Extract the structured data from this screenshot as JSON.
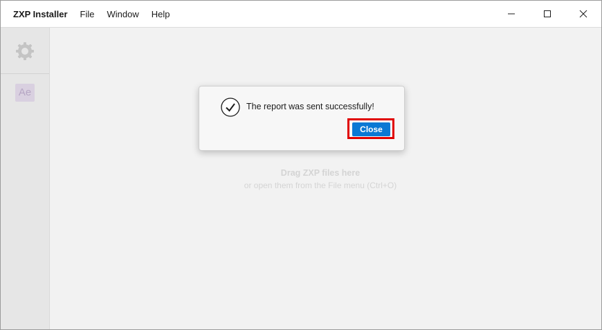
{
  "window": {
    "title": "ZXP Installer",
    "menu": [
      {
        "label": "File"
      },
      {
        "label": "Window"
      },
      {
        "label": "Help"
      }
    ],
    "controls": [
      "minimize-icon",
      "maximize-icon",
      "close-icon"
    ]
  },
  "sidebar": {
    "settings_icon": "gear-icon",
    "apps": [
      {
        "label": "Ae",
        "color": "#d9d0e0"
      }
    ]
  },
  "main": {
    "drop_hint_line1": "Drag ZXP files here",
    "drop_hint_line2": "or open them from the File menu (Ctrl+O)"
  },
  "dialog": {
    "icon": "checkmark-circle-icon",
    "message": "The report was sent successfully!",
    "close_label": "Close",
    "button_color": "#0a78d4",
    "highlight_color": "#e00000"
  }
}
